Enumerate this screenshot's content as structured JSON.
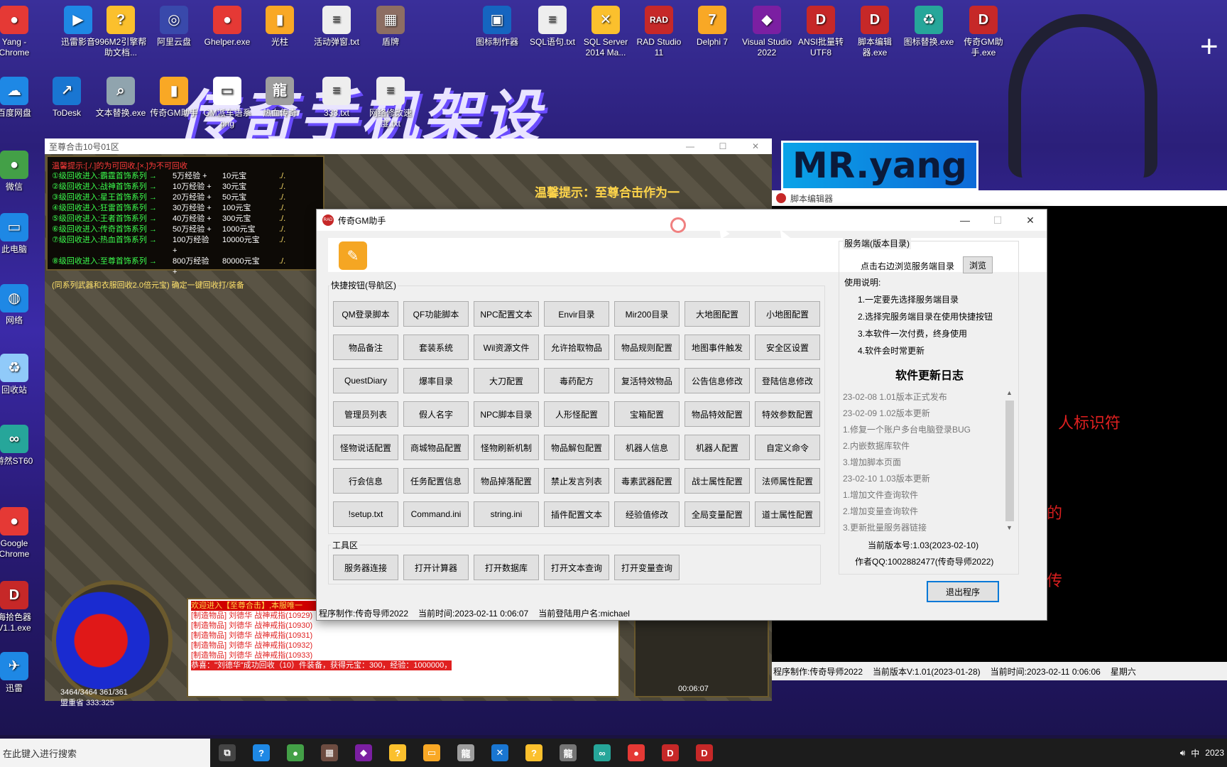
{
  "desktop": {
    "banner": "传奇手机架设",
    "brand": "MR.yang",
    "icons": [
      {
        "label": "Yang - Chrome",
        "color": "#e53935",
        "glyph": "●"
      },
      {
        "label": "迅雷影音",
        "color": "#1e88e5",
        "glyph": "▶"
      },
      {
        "label": "996M2引擎帮助文档...",
        "color": "#fbc02d",
        "glyph": "?"
      },
      {
        "label": "阿里云盘",
        "color": "#3949ab",
        "glyph": "◎"
      },
      {
        "label": "Ghelper.exe",
        "color": "#e53935",
        "glyph": "●"
      },
      {
        "label": "光柱",
        "color": "#f9a825",
        "glyph": "▮"
      },
      {
        "label": "活动弹窗.txt",
        "color": "#eeeeee",
        "glyph": "≡"
      },
      {
        "label": "盾牌",
        "color": "#8d6e63",
        "glyph": "▦"
      },
      {
        "label": "图标制作器",
        "color": "#1565c0",
        "glyph": "▣"
      },
      {
        "label": "SQL语句.txt",
        "color": "#eeeeee",
        "glyph": "≡"
      },
      {
        "label": "SQL Server 2014 Ma...",
        "color": "#fbc02d",
        "glyph": "✕"
      },
      {
        "label": "RAD Studio 11",
        "color": "#c62828",
        "glyph": "RAD"
      },
      {
        "label": "Delphi 7",
        "color": "#f9a825",
        "glyph": "7"
      },
      {
        "label": "Visual Studio 2022",
        "color": "#7b1fa2",
        "glyph": "◆"
      },
      {
        "label": "ANSI批量转UTF8",
        "color": "#c62828",
        "glyph": "D"
      },
      {
        "label": "脚本编辑器.exe",
        "color": "#c62828",
        "glyph": "D"
      },
      {
        "label": "图标替换.exe",
        "color": "#26a69a",
        "glyph": "♻"
      },
      {
        "label": "传奇GM助手.exe",
        "color": "#c62828",
        "glyph": "D"
      },
      {
        "label": "百度网盘",
        "color": "#1e88e5",
        "glyph": "☁"
      },
      {
        "label": "ToDesk",
        "color": "#1976d2",
        "glyph": "↗"
      },
      {
        "label": "文本替换.exe",
        "color": "#90a4ae",
        "glyph": "⌕"
      },
      {
        "label": "传奇GM助手",
        "color": "#f9a825",
        "glyph": "▮"
      },
      {
        "label": "GM派车语系png",
        "color": "#ffffff",
        "glyph": "▭"
      },
      {
        "label": "热血传奇",
        "color": "#9e9e9e",
        "glyph": "龍"
      },
      {
        "label": "333.txt",
        "color": "#eeeeee",
        "glyph": "≡"
      },
      {
        "label": "网络修改速度.txt",
        "color": "#eeeeee",
        "glyph": "≡"
      },
      {
        "label": "微信",
        "color": "#43a047",
        "glyph": "●"
      },
      {
        "label": "此电脑",
        "color": "#1e88e5",
        "glyph": "▭"
      },
      {
        "label": "网络",
        "color": "#1e88e5",
        "glyph": "◍"
      },
      {
        "label": "回收站",
        "color": "#90caf9",
        "glyph": "♻"
      },
      {
        "label": "游然ST60",
        "color": "#26a69a",
        "glyph": "∞"
      },
      {
        "label": "Google Chrome",
        "color": "#e53935",
        "glyph": "●"
      },
      {
        "label": "海拾色器V1.1.exe",
        "color": "#c62828",
        "glyph": "D"
      },
      {
        "label": "迅雷",
        "color": "#1e88e5",
        "glyph": "✈"
      }
    ]
  },
  "game_window": {
    "title": "至尊合击10号01区",
    "panel_header": "温馨提示:[./.]的为可回收,[×.]为不可回收",
    "rows": [
      {
        "name": "①级回收进入:霸霆首饰系列 →",
        "exp": "5万经验",
        "reward": "10元宝"
      },
      {
        "name": "②级回收进入:战神首饰系列 →",
        "exp": "10万经验",
        "reward": "30元宝"
      },
      {
        "name": "③级回收进入:星王首饰系列 →",
        "exp": "20万经验",
        "reward": "50元宝"
      },
      {
        "name": "④级回收进入:狂雷首饰系列 →",
        "exp": "30万经验",
        "reward": "100元宝"
      },
      {
        "name": "⑤级回收进入:王者首饰系列 →",
        "exp": "40万经验",
        "reward": "300元宝"
      },
      {
        "name": "⑥级回收进入:传奇首饰系列 →",
        "exp": "50万经验",
        "reward": "1000元宝"
      },
      {
        "name": "⑦级回收进入:热血首饰系列 →",
        "exp": "100万经验",
        "reward": "10000元宝"
      },
      {
        "name": "⑧级回收进入:至尊首饰系列 →",
        "exp": "800万经验",
        "reward": "80000元宝"
      }
    ],
    "panel_footer": "(同系列武器和衣服回收2.0倍元宝)  确定一键回收打/装备",
    "marquee": "温馨提示：至尊合击作为一",
    "chat": [
      "欢迎进入【至尊合击】,本服唯一",
      "[制造物品] 刘德华 战神戒指(10929)",
      "[制造物品] 刘德华 战神戒指(10930)",
      "[制造物品] 刘德华 战神戒指(10931)",
      "[制造物品] 刘德华 战神戒指(10932)",
      "[制造物品] 刘德华 战神戒指(10933)"
    ],
    "chat_highlight": "恭喜：\"刘德华\"成功回收（10）件装备，获得元宝：300，经验：1000000，",
    "hp": "3464/3464  361/361",
    "map": "盟重省  333:325",
    "time": "00:06:07"
  },
  "script_editor": {
    "title": "脚本编辑器",
    "red_text_1": "人标识符",
    "red_text_2": "的",
    "red_text_3": "传",
    "status_author": "程序制作:传奇导师2022",
    "status_version": "当前版本V:1.01(2023-01-28)",
    "status_time": "当前时间:2023-02-11 0:06:06",
    "status_weekday": "星期六"
  },
  "gm_helper": {
    "title": "传奇GM助手",
    "quick_group_label": "快捷按钮(导航区)",
    "quick_buttons": [
      [
        "QM登录脚本",
        "QF功能脚本",
        "NPC配置文本",
        "Envir目录",
        "Mir200目录",
        "大地图配置",
        "小地图配置"
      ],
      [
        "物品备注",
        "套装系统",
        "Wil资源文件",
        "允许拾取物品",
        "物品规则配置",
        "地图事件触发",
        "安全区设置"
      ],
      [
        "QuestDiary",
        "爆率目录",
        "大刀配置",
        "毒药配方",
        "复活特效物品",
        "公告信息修改",
        "登陆信息修改"
      ],
      [
        "管理员列表",
        "假人名字",
        "NPC脚本目录",
        "人形怪配置",
        "宝箱配置",
        "物品特效配置",
        "特效参数配置"
      ],
      [
        "怪物说话配置",
        "商城物品配置",
        "怪物刷新机制",
        "物品解包配置",
        "机器人信息",
        "机器人配置",
        "自定义命令"
      ],
      [
        "行会信息",
        "任务配置信息",
        "物品掉落配置",
        "禁止发言列表",
        "毒素武器配置",
        "战士属性配置",
        "法师属性配置"
      ],
      [
        "!setup.txt",
        "Command.ini",
        "string.ini",
        "插件配置文本",
        "经验值修改",
        "全局变量配置",
        "道士属性配置"
      ]
    ],
    "tools_group_label": "工具区",
    "tool_buttons": [
      "服务器连接",
      "打开计算器",
      "打开数据库",
      "打开文本查询",
      "打开变量查询"
    ],
    "side": {
      "group_label": "服务端(版本目录)",
      "browse_hint": "点击右边浏览服务端目录",
      "browse_label": "浏览",
      "usage_title": "使用说明:",
      "usage": [
        "1.一定要先选择服务端目录",
        "2.选择完服务端目录在使用快捷按钮",
        "3.本软件一次付费，终身使用",
        "4.软件会时常更新"
      ],
      "log_title": "软件更新日志",
      "log": [
        "23-02-08    1.01版本正式发布",
        "23-02-09    1.02版本更新",
        "  1.修复一个账户多台电脑登录BUG",
        "  2.内嵌数据库软件",
        "  3.增加脚本页面",
        "23-02-10       1.03版本更新",
        "  1.增加文件查询软件",
        "  2.增加变量查询软件",
        "  3.更新批量服务器链接"
      ],
      "version": "当前版本号:1.03(2023-02-10)",
      "qq": "作者QQ:1002882477(传奇导师2022)",
      "exit_label": "退出程序"
    },
    "status": {
      "author": "程序制作:传奇导师2022",
      "time": "当前时间:2023-02-11 0:06:07",
      "user": "当前登陆用户名:michael"
    }
  },
  "taskbar": {
    "search_placeholder": "在此键入进行搜索",
    "tray_lang": "中",
    "tray_year": "2023",
    "items": [
      {
        "name": "task-view",
        "color": "#444444",
        "glyph": "⧉"
      },
      {
        "name": "help",
        "color": "#1e88e5",
        "glyph": "?"
      },
      {
        "name": "wechat",
        "color": "#43a047",
        "glyph": "●"
      },
      {
        "name": "game",
        "color": "#6d4c41",
        "glyph": "▦"
      },
      {
        "name": "visual-studio",
        "color": "#7b1fa2",
        "glyph": "◆"
      },
      {
        "name": "help-doc",
        "color": "#fbc02d",
        "glyph": "?"
      },
      {
        "name": "file-explorer",
        "color": "#f9a825",
        "glyph": "▭"
      },
      {
        "name": "legend",
        "color": "#9e9e9e",
        "glyph": "龍"
      },
      {
        "name": "tool",
        "color": "#1976d2",
        "glyph": "✕"
      },
      {
        "name": "doc",
        "color": "#fbc02d",
        "glyph": "?"
      },
      {
        "name": "hot-blood",
        "color": "#757575",
        "glyph": "龍"
      },
      {
        "name": "st60",
        "color": "#26a69a",
        "glyph": "∞"
      },
      {
        "name": "recorder",
        "color": "#e53935",
        "glyph": "●"
      },
      {
        "name": "gm-helper",
        "color": "#c62828",
        "glyph": "D"
      },
      {
        "name": "script-editor",
        "color": "#c62828",
        "glyph": "D"
      }
    ]
  }
}
